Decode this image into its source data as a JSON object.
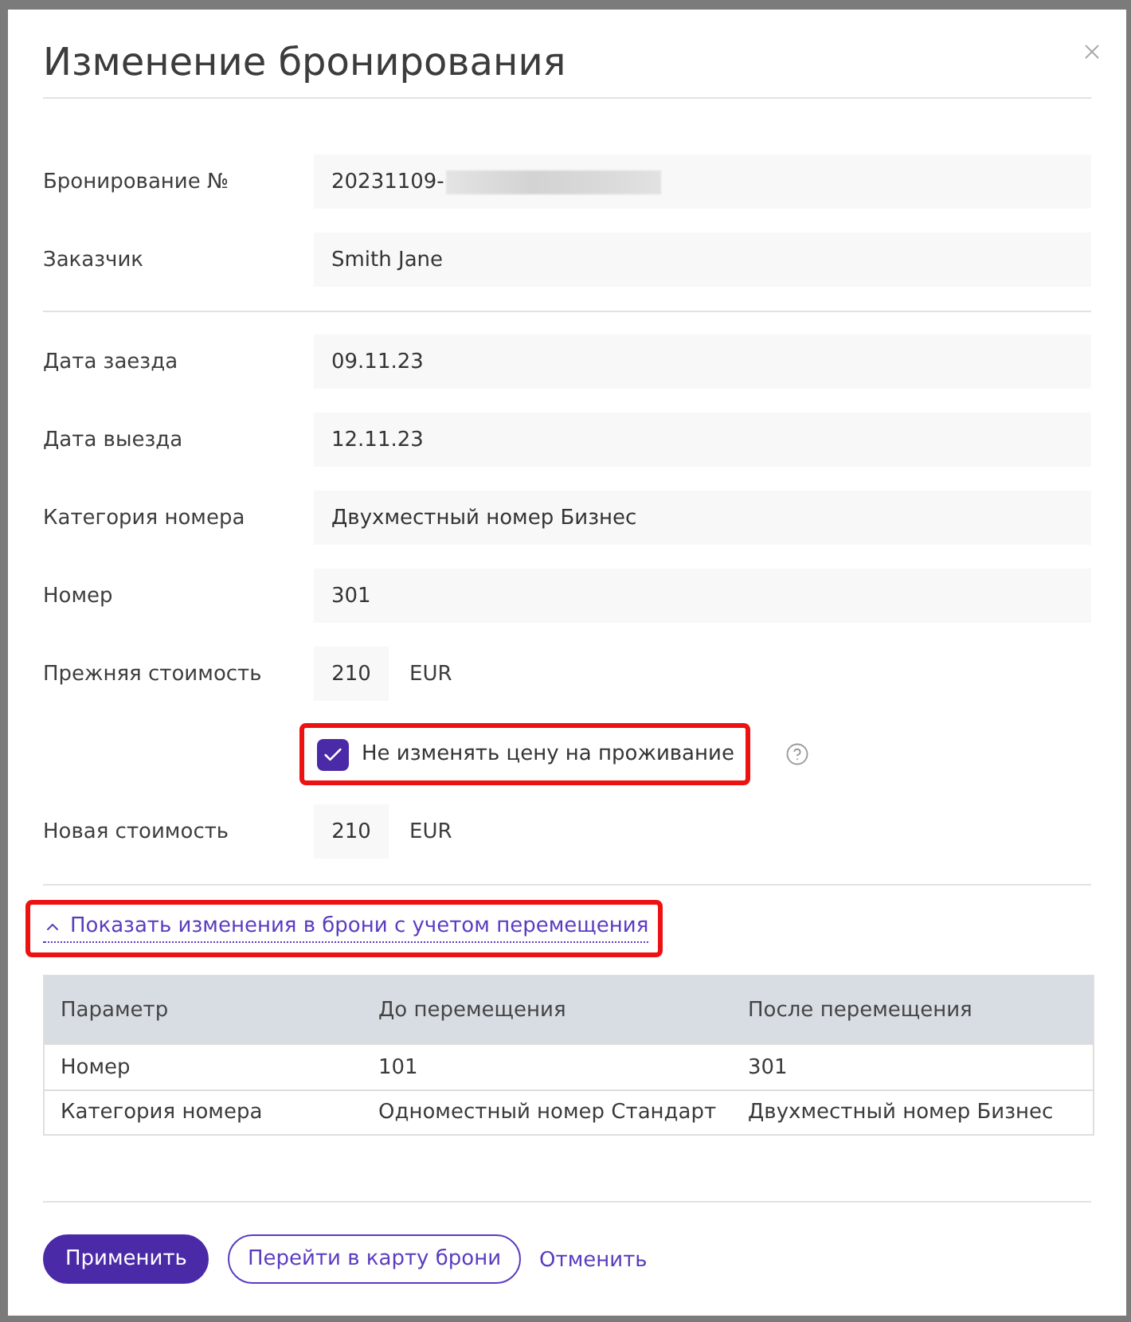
{
  "dialog": {
    "title": "Изменение бронирования"
  },
  "booking_fields": [
    {
      "label": "Бронирование №",
      "value": "20231109-",
      "redacted": true
    },
    {
      "label": "Заказчик",
      "value": "Smith Jane",
      "redacted": false
    }
  ],
  "stay_fields": [
    {
      "label": "Дата заезда",
      "value": "09.11.23"
    },
    {
      "label": "Дата выезда",
      "value": "12.11.23"
    },
    {
      "label": "Категория номера",
      "value": "Двухместный номер Бизнес"
    },
    {
      "label": "Номер",
      "value": "301"
    }
  ],
  "old_price": {
    "label": "Прежняя стоимость",
    "value": "210",
    "currency": "EUR"
  },
  "keep_price_checkbox": {
    "label": "Не изменять цену на проживание",
    "checked": true,
    "highlighted": true
  },
  "new_price": {
    "label": "Новая стоимость",
    "value": "210",
    "currency": "EUR"
  },
  "changes_toggle": {
    "label": "Показать изменения в брони с учетом перемещения",
    "expanded": true,
    "highlighted": true
  },
  "changes_table": {
    "columns": [
      "Параметр",
      "До перемещения",
      "После перемещения"
    ],
    "rows": [
      [
        "Номер",
        "101",
        "301"
      ],
      [
        "Категория номера",
        "Одноместный номер Стандарт",
        "Двухместный номер Бизнес"
      ]
    ]
  },
  "buttons": [
    {
      "label": "Применить",
      "kind": "primary"
    },
    {
      "label": "Перейти в карту брони",
      "kind": "outline"
    },
    {
      "label": "Отменить",
      "kind": "link"
    }
  ]
}
